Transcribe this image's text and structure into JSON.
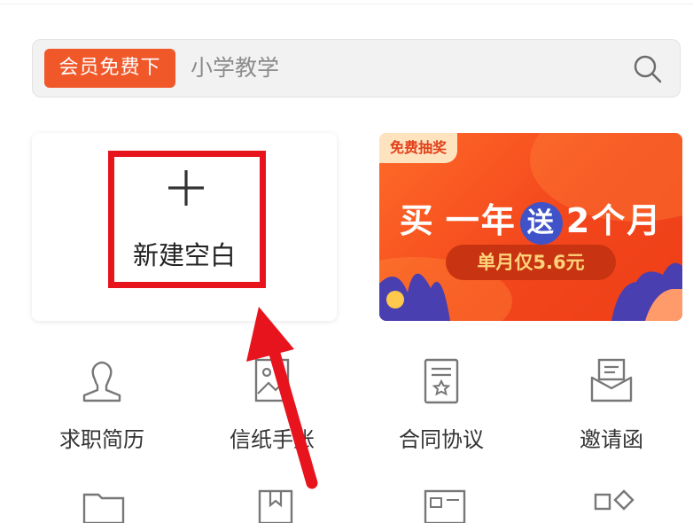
{
  "search": {
    "vip_chip": "会员免费下",
    "query": "小学教学"
  },
  "blank_card": {
    "label": "新建空白"
  },
  "promo": {
    "tag": "免费抽奖",
    "headline_buy": "买",
    "headline_year": "一年",
    "headline_gift": "送",
    "headline_months": "2个月",
    "price_pill": "单月仅5.6元"
  },
  "tools": [
    {
      "label": "求职简历",
      "icon": "resume-person-icon"
    },
    {
      "label": "信纸手账",
      "icon": "letter-paper-icon"
    },
    {
      "label": "合同协议",
      "icon": "contract-document-icon"
    },
    {
      "label": "邀请函",
      "icon": "invitation-envelope-icon"
    }
  ],
  "colors": {
    "accent": "#f0582a",
    "highlight": "#e8141d",
    "promo_blue": "#3f52c8"
  }
}
